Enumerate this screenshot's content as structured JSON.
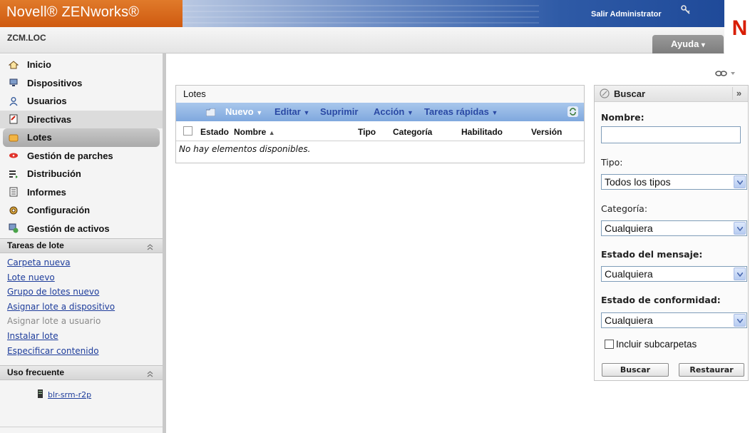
{
  "header": {
    "brand": "Novell® ZENworks®",
    "signout": "Salir Administrator",
    "zone": "ZCM.LOC",
    "help": "Ayuda",
    "logo_letter": "N"
  },
  "sidebar": {
    "nav": [
      {
        "label": "Inicio",
        "icon": "home-icon"
      },
      {
        "label": "Dispositivos",
        "icon": "monitor-icon"
      },
      {
        "label": "Usuarios",
        "icon": "user-icon"
      },
      {
        "label": "Directivas",
        "icon": "policy-icon"
      },
      {
        "label": "Lotes",
        "icon": "bundle-icon"
      },
      {
        "label": "Gestión de parches",
        "icon": "patch-icon"
      },
      {
        "label": "Distribución",
        "icon": "deployment-icon"
      },
      {
        "label": "Informes",
        "icon": "report-icon"
      },
      {
        "label": "Configuración",
        "icon": "config-icon"
      },
      {
        "label": "Gestión de activos",
        "icon": "asset-icon"
      }
    ],
    "tasks_title": "Tareas de lote",
    "tasks": [
      {
        "label": "Carpeta nueva",
        "enabled": true
      },
      {
        "label": "Lote nuevo",
        "enabled": true
      },
      {
        "label": "Grupo de lotes nuevo",
        "enabled": true
      },
      {
        "label": "Asignar lote a dispositivo",
        "enabled": true
      },
      {
        "label": "Asignar lote a usuario",
        "enabled": false
      },
      {
        "label": "Instalar lote",
        "enabled": true
      },
      {
        "label": "Especificar contenido",
        "enabled": true
      }
    ],
    "frequent_title": "Uso frecuente",
    "frequent_item": "blr-srm-r2p"
  },
  "lotes": {
    "title": "Lotes",
    "toolbar": {
      "new": "Nuevo",
      "edit": "Editar",
      "delete": "Suprimir",
      "action": "Acción",
      "quick": "Tareas rápidas"
    },
    "columns": [
      "Estado",
      "Nombre",
      "Tipo",
      "Categoría",
      "Habilitado",
      "Versión"
    ],
    "sort_indicator": "▲",
    "empty": "No hay elementos disponibles."
  },
  "search": {
    "title": "Buscar",
    "name_label": "Nombre:",
    "name_value": "",
    "type_label": "Tipo:",
    "type_value": "Todos los tipos",
    "category_label": "Categoría:",
    "category_value": "Cualquiera",
    "message_label": "Estado del mensaje:",
    "message_value": "Cualquiera",
    "compliance_label": "Estado de conformidad:",
    "compliance_value": "Cualquiera",
    "subfolders_label": "Incluir subcarpetas",
    "subfolders_checked": false,
    "search_button": "Buscar",
    "reset_button": "Restaurar"
  },
  "colors": {
    "brand_orange": "#d9661b",
    "banner_blue": "#2e5aa6",
    "link_blue": "#1d3c9b",
    "toolbar_blue": "#8fb3e4",
    "novell_red": "#d81e05"
  }
}
